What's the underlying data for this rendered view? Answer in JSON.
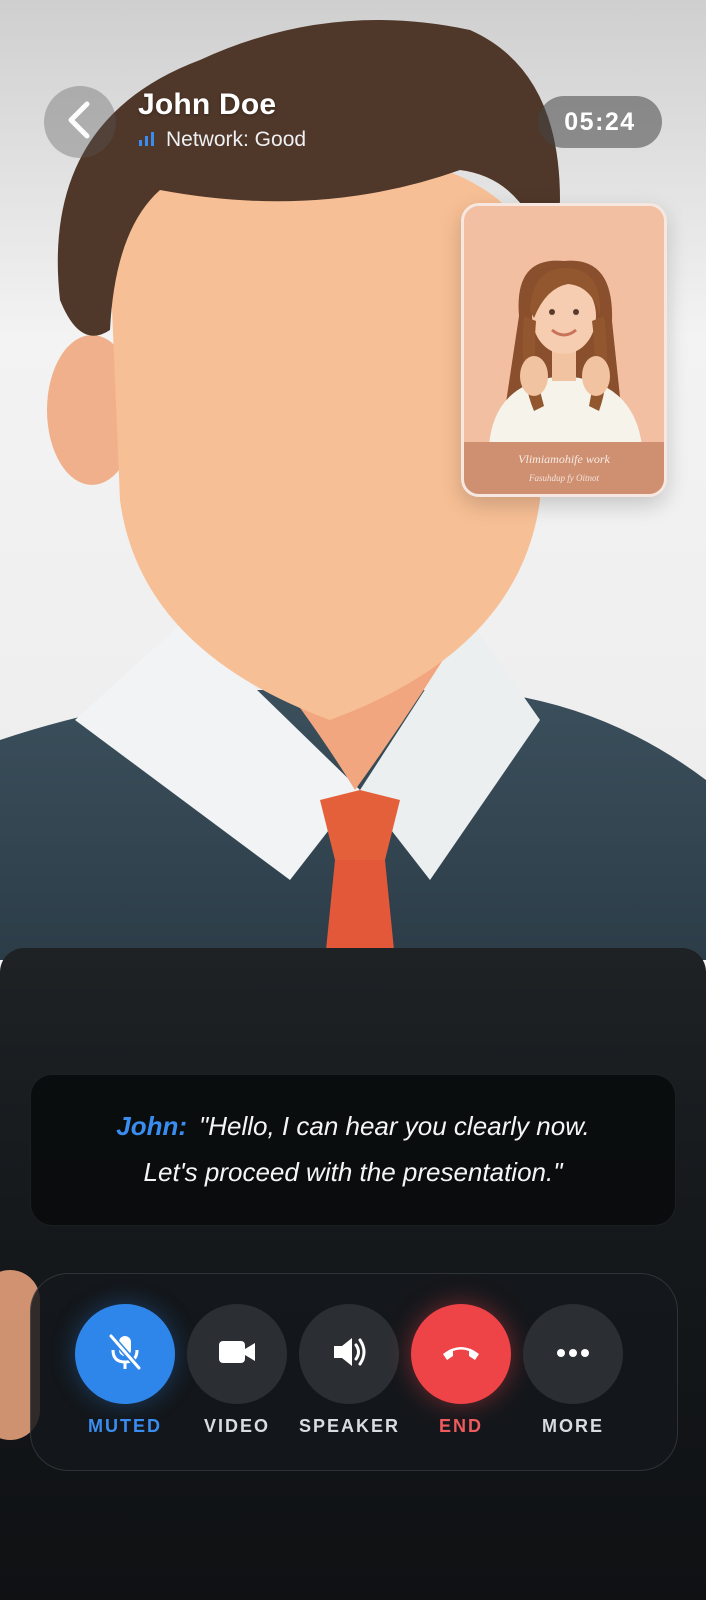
{
  "header": {
    "caller_name": "John Doe",
    "network_status": "Network: Good",
    "call_timer": "05:24",
    "icons": {
      "back": "chevron-left-icon",
      "signal": "signal-bars-icon"
    }
  },
  "self_view": {
    "caption_line1": "Vlimiamohife work",
    "caption_line2": "Fasuhdup fy Oitnot"
  },
  "caption": {
    "speaker": "John:",
    "text_line1": "\"Hello, I can hear you clearly now.",
    "text_line2": "Let's proceed with the presentation.\""
  },
  "controls": [
    {
      "id": "mute",
      "label": "MUTED",
      "icon": "mic-off-icon",
      "active": true,
      "color": "#2f86ea"
    },
    {
      "id": "video",
      "label": "VIDEO",
      "icon": "video-camera-icon"
    },
    {
      "id": "speaker",
      "label": "SPEAKER",
      "icon": "speaker-icon"
    },
    {
      "id": "end",
      "label": "END",
      "icon": "phone-hangup-icon",
      "color": "#ee4347"
    },
    {
      "id": "more",
      "label": "MORE",
      "icon": "more-dots-icon"
    }
  ],
  "colors": {
    "accent": "#3a8df0",
    "danger": "#ee4347"
  }
}
